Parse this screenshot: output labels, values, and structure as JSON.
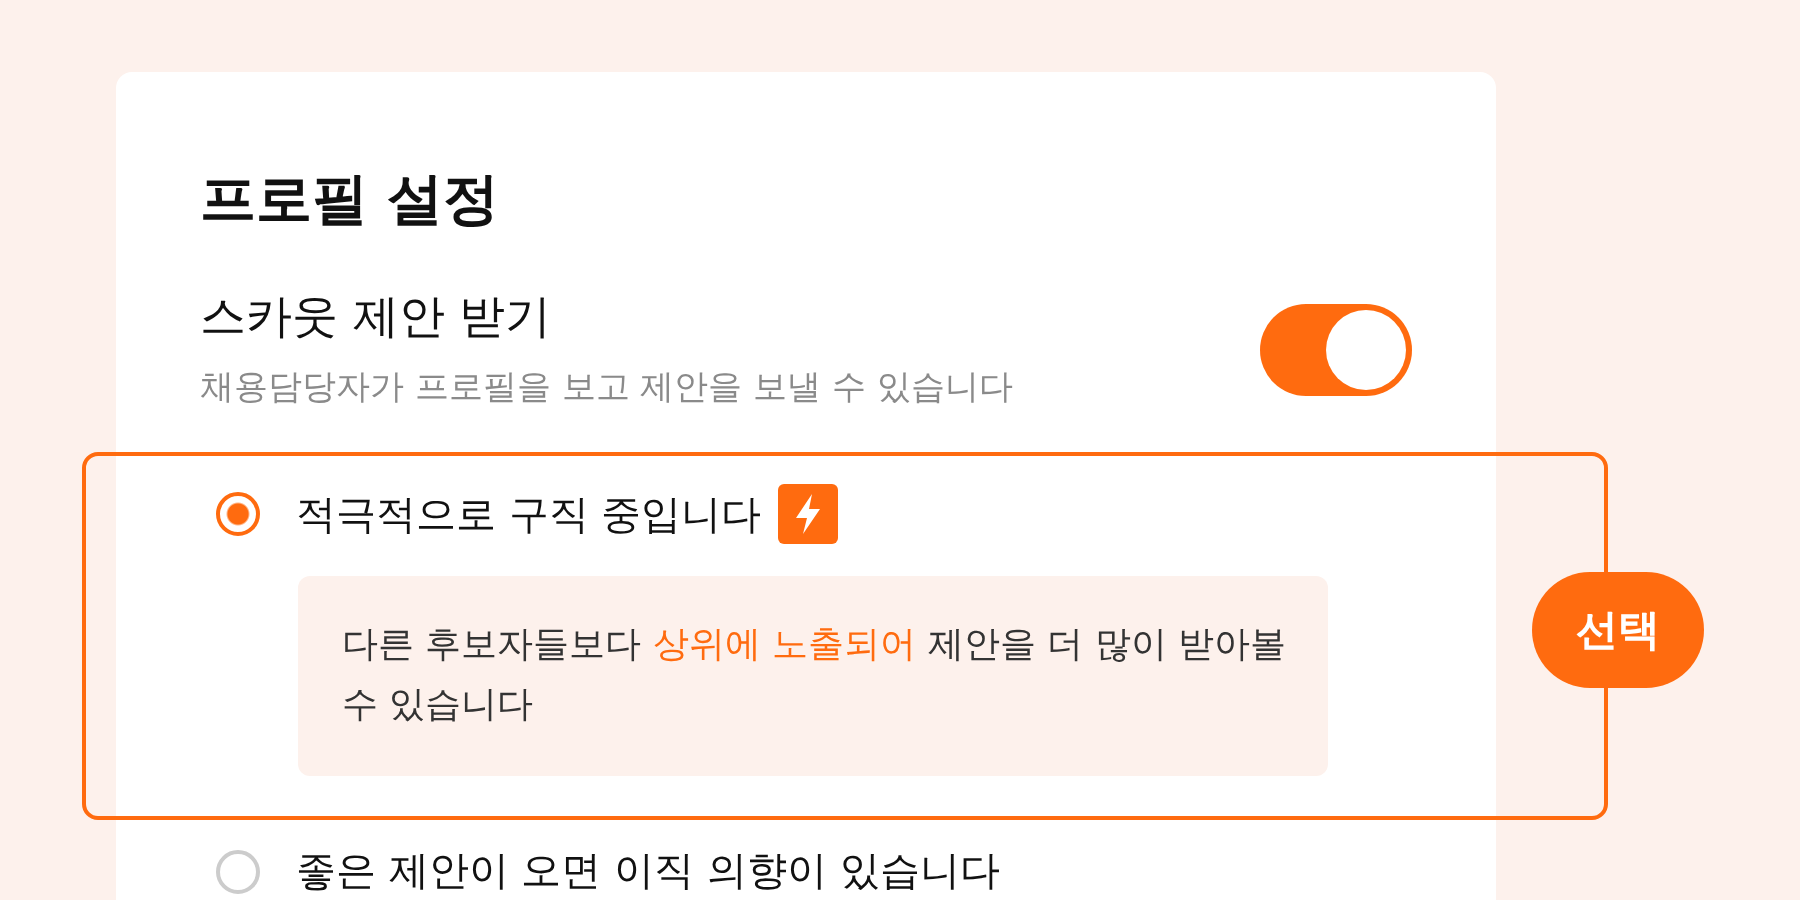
{
  "title": "프로필 설정",
  "scout": {
    "label": "스카웃 제안 받기",
    "description": "채용담당자가 프로필을 보고 제안을 보낼 수 있습니다",
    "on": true
  },
  "options": [
    {
      "label": "적극적으로 구직 중입니다",
      "selected": true,
      "kind": "boosted",
      "badge": "선택",
      "detail": [
        {
          "text": "다른 후보자들보다 ",
          "emphasis": false
        },
        {
          "text": "상위에 노출되어",
          "emphasis": true
        },
        {
          "text": " 제안을 더 많이 받아볼 수 있습니다",
          "emphasis": false
        }
      ]
    },
    {
      "label": "좋은 제안이 오면 이직 의향이 있습니다",
      "selected": false,
      "kind": "plain"
    }
  ]
}
